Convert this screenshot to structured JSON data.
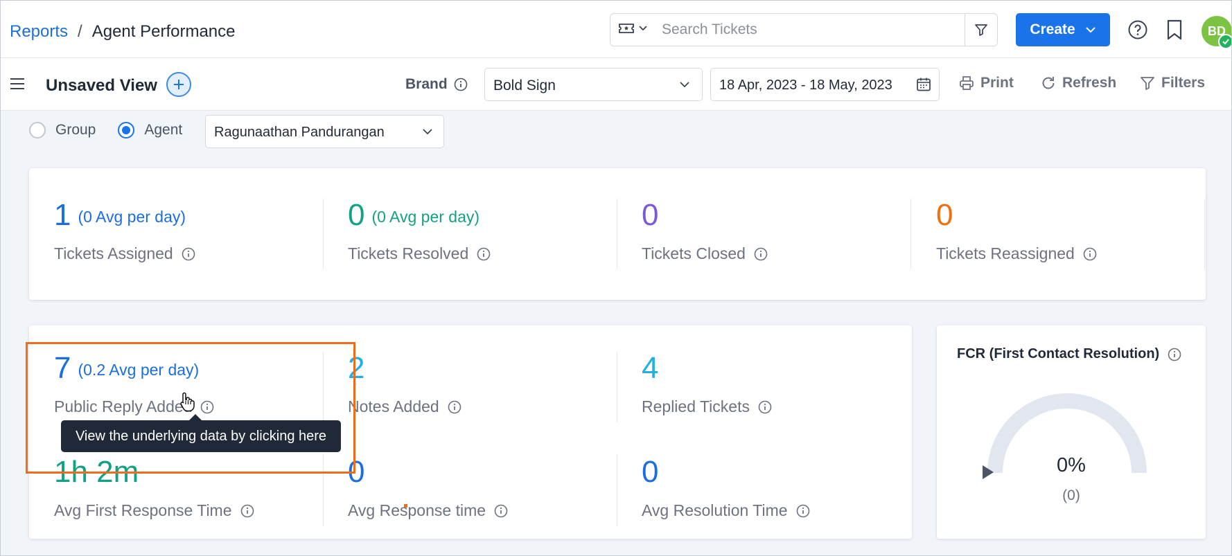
{
  "header": {
    "breadcrumb_root": "Reports",
    "breadcrumb_separator": "/",
    "breadcrumb_current": "Agent Performance",
    "search_placeholder": "Search Tickets",
    "create_label": "Create",
    "avatar_initials": "BD"
  },
  "viewbar": {
    "view_title": "Unsaved View",
    "brand_label": "Brand",
    "brand_value": "Bold Sign",
    "date_range": "18 Apr, 2023 - 18 May, 2023",
    "print_label": "Print",
    "refresh_label": "Refresh",
    "filters_label": "Filters"
  },
  "filters": {
    "group_label": "Group",
    "agent_label": "Agent",
    "selected_mode": "Agent",
    "agent_value": "Ragunaathan Pandurangan"
  },
  "summary": [
    {
      "value": "1",
      "avg": "(0 Avg per day)",
      "label": "Tickets Assigned"
    },
    {
      "value": "0",
      "avg": "(0 Avg per day)",
      "label": "Tickets Resolved"
    },
    {
      "value": "0",
      "avg": "",
      "label": "Tickets Closed"
    },
    {
      "value": "0",
      "avg": "",
      "label": "Tickets Reassigned"
    }
  ],
  "metrics": [
    {
      "value": "7",
      "avg": "(0.2 Avg per day)",
      "label": "Public Reply Added"
    },
    {
      "value": "2",
      "avg": "",
      "label": "Notes Added"
    },
    {
      "value": "4",
      "avg": "",
      "label": "Replied Tickets"
    },
    {
      "value": "1h 2m",
      "avg": "",
      "label": "Avg First Response Time"
    },
    {
      "value": "0",
      "avg": "",
      "label": "Avg Response time"
    },
    {
      "value": "0",
      "avg": "",
      "label": "Avg Resolution Time"
    }
  ],
  "fcr": {
    "title": "FCR (First Contact Resolution)",
    "percent_text": "0%",
    "count_text": "(0)",
    "fraction": 0
  },
  "tooltip": {
    "text": "View the underlying data by clicking here"
  },
  "colors": {
    "accent": "#1a73e8",
    "blue": "#1a6ee0",
    "green": "#13a185",
    "purple": "#7a59d9",
    "orange": "#f06f0f",
    "cyan": "#1fb0e8",
    "highlight": "#ef6c1a"
  },
  "icons": {
    "search_type": "ticket-icon",
    "search_filter": "funnel-icon",
    "help": "help-circle-icon",
    "bookmark": "bookmark-icon",
    "menu": "hamburger-icon",
    "add_view": "plus-icon",
    "info": "info-icon",
    "calendar": "calendar-icon",
    "print": "printer-icon",
    "refresh": "refresh-icon",
    "filters": "funnel-icon"
  }
}
